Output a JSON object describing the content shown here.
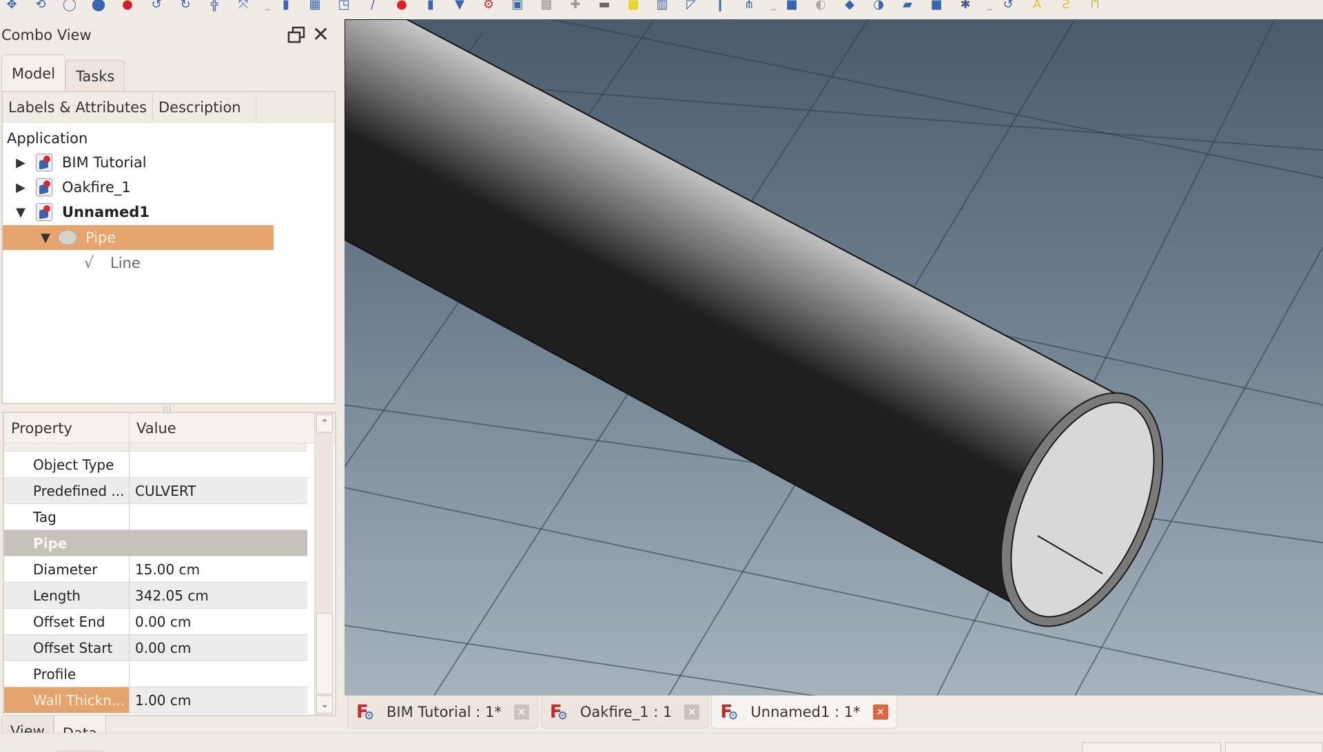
{
  "toolbar": {
    "icons": [
      "move-icon",
      "rotate-icon",
      "offset-icon",
      "scale-icon",
      "red-pin-icon",
      "upgrade-icon",
      "downgrade-icon",
      "split-icon",
      "join-icon",
      "wire-icon",
      "array-icon",
      "path-array-icon",
      "line-icon",
      "red-sphere-icon",
      "wall-icon",
      "structure-icon",
      "rebar-icon",
      "window-icon",
      "grey-box-icon",
      "add-icon",
      "remove-icon",
      "yellow-cube-icon",
      "columns-icon",
      "stairs-icon",
      "beam-icon",
      "frame-icon",
      "blue-box-icon",
      "grey-shape-icon",
      "blue-shape-icon",
      "link-icon",
      "panel-icon",
      "equipment-icon",
      "settings-icon",
      "curve-icon",
      "text-icon",
      "dimension-icon",
      "measure-icon"
    ]
  },
  "combo_view": {
    "title": "Combo View",
    "tabs": [
      {
        "label": "Model"
      },
      {
        "label": "Tasks"
      }
    ],
    "tree_columns": [
      "Labels & Attributes",
      "Description"
    ],
    "tree": {
      "root": "Application",
      "items": [
        {
          "label": "BIM Tutorial",
          "expanded": false
        },
        {
          "label": "Oakfire_1",
          "expanded": false
        },
        {
          "label": "Unnamed1",
          "expanded": true,
          "bold": true
        },
        {
          "label": "Pipe",
          "expanded": true,
          "selected": true
        },
        {
          "label": "Line"
        }
      ]
    },
    "property_columns": [
      "Property",
      "Value"
    ],
    "properties": [
      {
        "name": "Object Type",
        "value": ""
      },
      {
        "name": "Predefined ...",
        "value": "CULVERT"
      },
      {
        "name": "Tag",
        "value": ""
      },
      {
        "name": "Pipe",
        "value": "",
        "group": true
      },
      {
        "name": "Diameter",
        "value": "15.00 cm"
      },
      {
        "name": "Length",
        "value": "342.05 cm"
      },
      {
        "name": "Offset End",
        "value": "0.00 cm"
      },
      {
        "name": "Offset Start",
        "value": "0.00 cm"
      },
      {
        "name": "Profile",
        "value": ""
      },
      {
        "name": "Wall Thickn...",
        "value": "1.00 cm",
        "selected": true
      }
    ],
    "bottom_tabs": [
      {
        "label": "View"
      },
      {
        "label": "Data"
      }
    ]
  },
  "document_tabs": [
    {
      "label": "BIM Tutorial : 1*",
      "active": false
    },
    {
      "label": "Oakfire_1 : 1",
      "active": false
    },
    {
      "label": "Unnamed1 : 1*",
      "active": true
    }
  ],
  "colors": {
    "selection": "#e6a46e",
    "close_active": "#e0663f",
    "viewport_top": "#4a5b6b",
    "viewport_bottom": "#a6b3bc"
  }
}
